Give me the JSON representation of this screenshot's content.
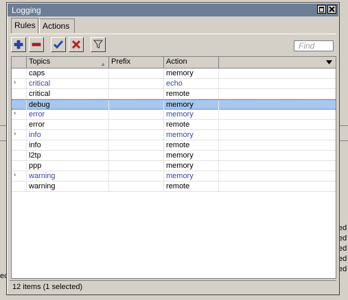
{
  "window": {
    "title": "Logging"
  },
  "tabs": [
    {
      "label": "Rules",
      "active": true
    },
    {
      "label": "Actions",
      "active": false
    }
  ],
  "toolbar": {
    "buttons": [
      {
        "name": "add-icon",
        "color": "#1d48b4"
      },
      {
        "name": "remove-icon",
        "color": "#b41d1d"
      },
      {
        "name": "enable-check-icon",
        "color": "#1d48b4"
      },
      {
        "name": "disable-x-icon",
        "color": "#c41a1a"
      },
      {
        "name": "filter-icon",
        "color": "#404040"
      }
    ],
    "find_placeholder": "Find"
  },
  "table": {
    "columns": [
      "Topics",
      "Prefix",
      "Action"
    ],
    "rows": [
      {
        "flag": "",
        "topics": "caps",
        "prefix": "",
        "action": "memory",
        "disabled": false,
        "selected": false
      },
      {
        "flag": "*",
        "topics": "critical",
        "prefix": "",
        "action": "echo",
        "disabled": true,
        "selected": false
      },
      {
        "flag": "",
        "topics": "critical",
        "prefix": "",
        "action": "remote",
        "disabled": false,
        "selected": false
      },
      {
        "flag": "",
        "topics": "debug",
        "prefix": "",
        "action": "memory",
        "disabled": false,
        "selected": true
      },
      {
        "flag": "*",
        "topics": "error",
        "prefix": "",
        "action": "memory",
        "disabled": true,
        "selected": false
      },
      {
        "flag": "",
        "topics": "error",
        "prefix": "",
        "action": "remote",
        "disabled": false,
        "selected": false
      },
      {
        "flag": "*",
        "topics": "info",
        "prefix": "",
        "action": "memory",
        "disabled": true,
        "selected": false
      },
      {
        "flag": "",
        "topics": "info",
        "prefix": "",
        "action": "remote",
        "disabled": false,
        "selected": false
      },
      {
        "flag": "",
        "topics": "l2tp",
        "prefix": "",
        "action": "memory",
        "disabled": false,
        "selected": false
      },
      {
        "flag": "",
        "topics": "ppp",
        "prefix": "",
        "action": "memory",
        "disabled": false,
        "selected": false
      },
      {
        "flag": "*",
        "topics": "warning",
        "prefix": "",
        "action": "memory",
        "disabled": true,
        "selected": false
      },
      {
        "flag": "",
        "topics": "warning",
        "prefix": "",
        "action": "remote",
        "disabled": false,
        "selected": false
      }
    ]
  },
  "status": {
    "text": "12 items (1 selected)"
  },
  "background": {
    "right_fragments": [
      "ed",
      "ed",
      "ed",
      "ed",
      "ed"
    ],
    "left_fragment": "ec"
  }
}
